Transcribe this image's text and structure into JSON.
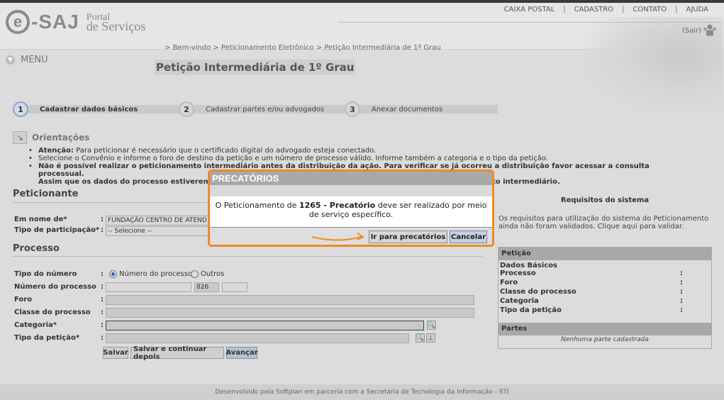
{
  "header": {
    "logo_e": "e",
    "logo_saj": "-SAJ",
    "logo_portal_l1": "Portal",
    "logo_portal_l2": "de Serviços",
    "nav": [
      "CAIXA POSTAL",
      "CADASTRO",
      "CONTATO",
      "AJUDA"
    ],
    "nav_sep": "|",
    "sair": "(Sair)",
    "breadcrumb": "> Bem-vindo > Peticionamento Eletrônico > Petição Intermediária de 1º Grau"
  },
  "menu": {
    "label": "MENU"
  },
  "page_title": "Petição Intermediária de 1º Grau",
  "steps": [
    {
      "num": "1",
      "label": "Cadastrar dados básicos"
    },
    {
      "num": "2",
      "label": "Cadastrar partes e/ou advogados"
    },
    {
      "num": "3",
      "label": "Anexar documentos"
    }
  ],
  "orientacoes": {
    "title": "Orientações",
    "lines": [
      {
        "bold": "Atenção:",
        "text": " Para peticionar é necessário que o certificado digital do advogado esteja conectado."
      },
      {
        "bold": "",
        "text": "Selecione o Convênio e informe o foro de destino da petição e um número de processo válido. Informe também a categoria e o tipo da petição."
      },
      {
        "bold": "Não é possível realizar o peticionamento intermediário antes da distribuição da ação. Para verificar se já ocorreu a distribuição favor acessar a consulta processual.",
        "text": ""
      },
      {
        "bold": "Assim que os dados do processo estiverem disp",
        "text": "",
        "bold_tail": "to intermediário."
      }
    ]
  },
  "peticionante": {
    "title": "Peticionante",
    "em_nome_de_label": "Em nome de*",
    "em_nome_de_value": "FUNDAÇÃO CENTRO DE ATEND",
    "tipo_participacao_label": "Tipo de participação*",
    "tipo_participacao_value": "-- Selecione --"
  },
  "processo": {
    "title": "Processo",
    "tipo_numero_label": "Tipo do número",
    "radio_numero": "Número do processo",
    "radio_outros": "Outros",
    "numero_label": "Número do processo",
    "numero_part2": "826",
    "foro_label": "Foro",
    "classe_label": "Classe do processo",
    "categoria_label": "Categoria*",
    "tipo_peticao_label": "Tipo da petição*",
    "colon": ":"
  },
  "buttons": {
    "salvar": "Salvar",
    "salvar_continuar": "Salvar e continuar depois",
    "avancar": "Avançar"
  },
  "requisitos": {
    "title": "Requisitos do sistema",
    "text": "Os requisitos para utilização do sistema do Peticionamento ainda não foram validados. Clique aqui para validar."
  },
  "peticao_box": {
    "title": "Petição",
    "dados_basicos": "Dados Básicos",
    "rows": [
      "Processo",
      "Foro",
      "Classe do processo",
      "Categoria",
      "Tipo da petição"
    ],
    "colon": ":",
    "partes_title": "Partes",
    "partes_none": "Nenhuma parte cadastrada"
  },
  "footer": {
    "text": "Desenvolvido pela Softplan em parceria com a Secretaria de Tecnologia da Informação - STI"
  },
  "modal": {
    "title": "PRECATÓRIOS",
    "msg_pre": "O Peticionamento de ",
    "msg_bold": "1265 - Precatório",
    "msg_post": " deve ser realizado por meio de serviço específico.",
    "btn_go": "Ir para precatórios",
    "btn_cancel": "Cancelar",
    "accent": "#ee8a22"
  }
}
